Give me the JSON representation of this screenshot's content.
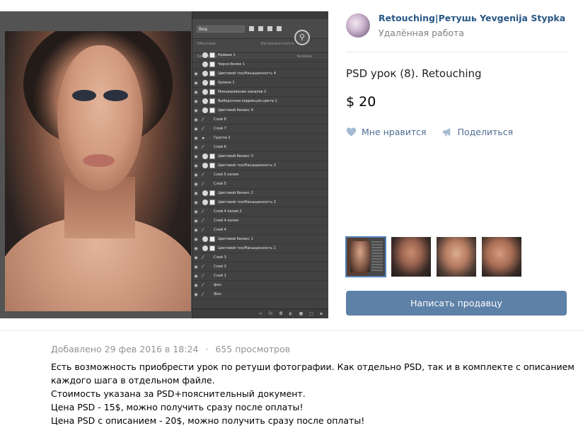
{
  "seller": {
    "name": "Retouching|Ретушь Yevgenija Stypka",
    "subtitle": "Удалённая работа"
  },
  "product": {
    "title": "PSD урок (8). Retouching",
    "price": "$ 20"
  },
  "actions": {
    "like_label": "Мне нравится",
    "share_label": "Поделиться"
  },
  "write_seller_label": "Написать продавцу",
  "thumbnails": [
    {
      "name": "photoshop-screenshot",
      "selected": true
    },
    {
      "name": "portrait-1",
      "selected": false
    },
    {
      "name": "portrait-2",
      "selected": false
    },
    {
      "name": "portrait-3",
      "selected": false
    }
  ],
  "meta": {
    "added": "Добавлено 29 фев 2016 в 18:24",
    "separator": "·",
    "views": "655 просмотров"
  },
  "description": [
    "Есть возможность приобрести урок по ретуши фотографии. Как отдельно PSD, так и в комплекте с описанием",
    "каждого шага в отдельном файле.",
    "Стоимость указана за PSD+пояснительный документ.",
    "Цена PSD - 15$, можно получить сразу после оплаты!",
    "Цена PSD с описанием - 20$, можно получить сразу после оплаты!"
  ],
  "photoshop": {
    "kind_select": "Вид",
    "blend_mode": "Обычные",
    "opacity_label": "Непрозрачность",
    "lock_label": "Закрепить:",
    "fill_label": "Заливка",
    "layers": [
      {
        "name": "Кривые 1",
        "type": "adj"
      },
      {
        "name": "Черно-белое 1",
        "type": "adj"
      },
      {
        "name": "Цветовой тон/Насыщенность 4",
        "type": "adj"
      },
      {
        "name": "Уровни 1",
        "type": "adj"
      },
      {
        "name": "Микширование каналов 2",
        "type": "adj"
      },
      {
        "name": "Выборочная коррекция цвета 1",
        "type": "adj"
      },
      {
        "name": "Цветовой баланс 4",
        "type": "adj"
      },
      {
        "name": "Слой 8",
        "type": "brush"
      },
      {
        "name": "Слой 7",
        "type": "brush"
      },
      {
        "name": "Группа 1",
        "type": "group"
      },
      {
        "name": "Слой 6",
        "type": "brush"
      },
      {
        "name": "Цветовой баланс 3",
        "type": "adj"
      },
      {
        "name": "Цветовой тон/Насыщенность 3",
        "type": "adj"
      },
      {
        "name": "Слой 5 копия",
        "type": "brush"
      },
      {
        "name": "Слой 5",
        "type": "brush"
      },
      {
        "name": "Цветовой баланс 2",
        "type": "adj"
      },
      {
        "name": "Цветовой тон/Насыщенность 2",
        "type": "adj"
      },
      {
        "name": "Слой 4 копия 2",
        "type": "brush"
      },
      {
        "name": "Слой 4 копия",
        "type": "brush"
      },
      {
        "name": "Слой 4",
        "type": "brush"
      },
      {
        "name": "Цветовой баланс 1",
        "type": "adj"
      },
      {
        "name": "Цветовой тон/Насыщенность 1",
        "type": "adj"
      },
      {
        "name": "Слой 3",
        "type": "brush"
      },
      {
        "name": "Слой 2",
        "type": "brush"
      },
      {
        "name": "Слой 1",
        "type": "brush"
      },
      {
        "name": "фон",
        "type": "brush"
      },
      {
        "name": "Фон",
        "type": "brush"
      }
    ]
  },
  "colors": {
    "link": "#2a5885",
    "button": "#5e81a8",
    "action": "#4f6d92",
    "muted": "#939393"
  }
}
